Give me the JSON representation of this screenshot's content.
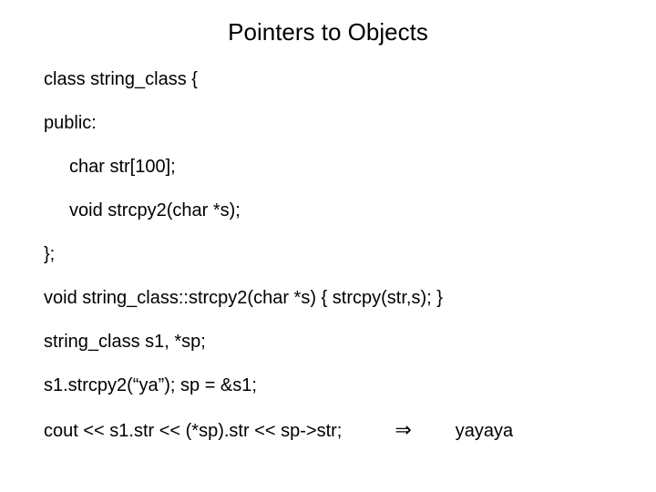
{
  "title": "Pointers to Objects",
  "lines": {
    "l1": "class string_class {",
    "l2": "public:",
    "l3": "char str[100];",
    "l4": "void strcpy2(char *s);",
    "l5": "};",
    "l6": "void string_class::strcpy2(char *s) { strcpy(str,s); }",
    "l7": "string_class s1, *sp;",
    "l8": "s1.strcpy2(“ya”);  sp = &s1;",
    "l9": "cout << s1.str << (*sp).str << sp->str;"
  },
  "arrow": "⇒",
  "output": "yayaya"
}
